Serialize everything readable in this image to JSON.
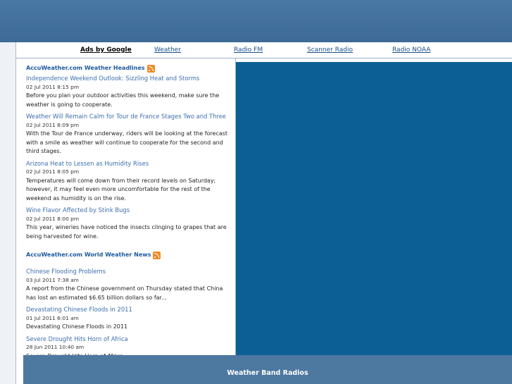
{
  "adbar": {
    "ads_label": "Ads by Google",
    "links": [
      "Weather",
      "Radio FM",
      "Scanner Radio",
      "Radio NOAA"
    ]
  },
  "headlines": {
    "title": "AccuWeather.com Weather Headlines",
    "items": [
      {
        "title": "Independence Weekend Outlook: Sizzling Heat and Storms",
        "date": "02 Jul 2011 8:15 pm",
        "desc": "Before you plan your outdoor activities this weekend, make sure the weather is going to cooperate."
      },
      {
        "title": "Weather Will Remain Calm for Tour de France Stages Two and Three",
        "date": "02 Jul 2011 8:09 pm",
        "desc": "With the Tour de France underway, riders will be looking at the forecast with a smile as weather will continue to cooperate for the second and third stages."
      },
      {
        "title": "Arizona Heat to Lessen as Humidity Rises",
        "date": "02 Jul 2011 8:05 pm",
        "desc": "Temperatures will come down from their record levels on Saturday; however, it may feel even more uncomfortable for the rest of the weekend as humidity is on the rise."
      },
      {
        "title": "Wine Flavor Affected by Stink Bugs",
        "date": "02 Jul 2011 8:00 pm",
        "desc": "This year, wineries have noticed the insects clinging to grapes that are being harvested for wine."
      }
    ]
  },
  "world": {
    "title": "AccuWeather.com World Weather News",
    "items": [
      {
        "title": "Chinese Flooding Problems",
        "date": "03 Jul 2011 7:38 am",
        "desc": "A report from the Chinese government on Thursday stated that China has lost an estimated $6.65 billion dollars so far..."
      },
      {
        "title": "Devastating Chinese Floods in 2011",
        "date": "01 Jul 2011 6:01 am",
        "desc": "Devastating Chinese Floods in 2011"
      },
      {
        "title": "Severe Drought Hits Horn of Africa",
        "date": "28 Jun 2011 10:40 am",
        "desc": "Severe Drought Hits Horn of Africa"
      }
    ]
  },
  "bottom": {
    "label": "Weather Band Radios"
  },
  "colors": {
    "header_blue": "#3f6a94",
    "panel_blue": "#0b5f94",
    "link_blue": "#3d6fae"
  },
  "icons": {
    "feed": "rss-icon"
  }
}
